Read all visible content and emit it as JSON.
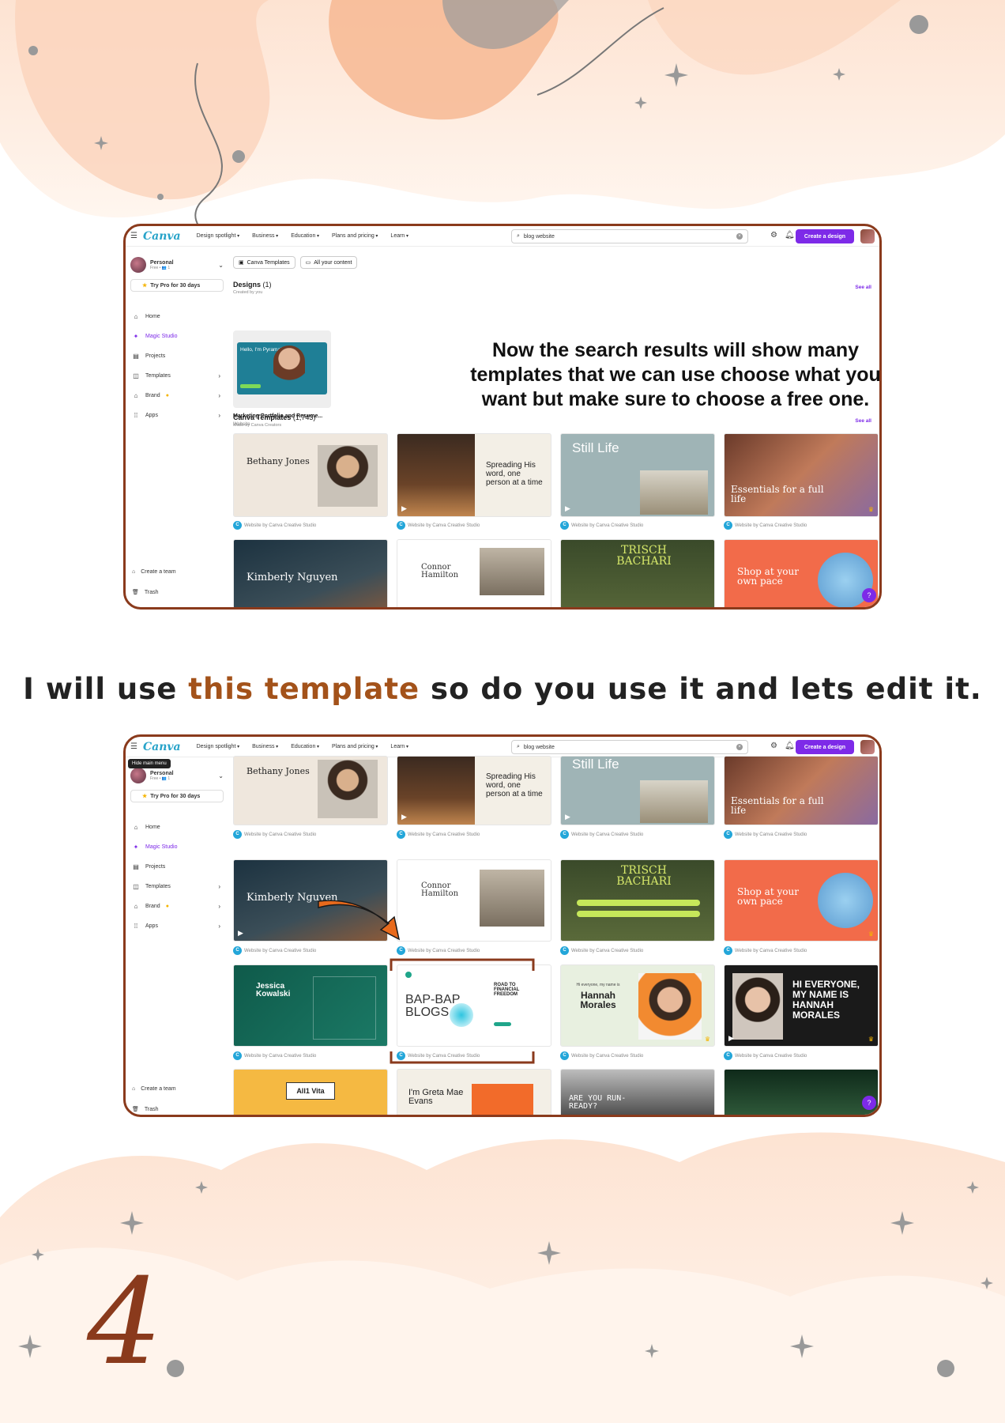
{
  "colors": {
    "accent": "#7d2ae8",
    "frame": "#8a3a1c",
    "highlight": "#a3521a",
    "brand": "#27a3c9"
  },
  "canva": {
    "logo": "Canva",
    "menu_icon": "menu-icon",
    "nav": [
      "Design spotlight",
      "Business",
      "Education",
      "Plans and pricing",
      "Learn"
    ],
    "search_value": "blog website",
    "create_button": "Create a design",
    "account": {
      "name": "Personal",
      "plan": "Free • 👥 1"
    },
    "try_pro": "Try Pro for 30 days",
    "sidebar": [
      {
        "label": "Home",
        "icon": "home-icon"
      },
      {
        "label": "Magic Studio",
        "icon": "sparkle-icon"
      },
      {
        "label": "Projects",
        "icon": "folder-icon"
      },
      {
        "label": "Templates",
        "icon": "templates-icon"
      },
      {
        "label": "Brand",
        "icon": "brand-icon"
      },
      {
        "label": "Apps",
        "icon": "apps-icon"
      }
    ],
    "create_team": "Create a team",
    "trash": "Trash",
    "template_card_label": "Website by Canva Creative Studio",
    "tooltip": "Hide main menu"
  },
  "screen1": {
    "chips": [
      "Canva Templates",
      "All your content"
    ],
    "designs_title": "Designs",
    "designs_count": "(1)",
    "designs_sub": "Created by you",
    "see_all": "See all",
    "design_card": {
      "thumb_text": "Hello, I'm Pyramaka",
      "name": "Marketing Portfolio and Resume...",
      "type": "Website"
    },
    "templates_title": "Canva Templates",
    "templates_count": "(1,743)",
    "templates_sub": "Made by Canva Creators",
    "callout": "Now the search results will show many templates that we can use choose what you want but make sure to choose a free one.",
    "row1": [
      "Bethany Jones",
      "Spreading His word, one person at a time",
      "Still Life",
      "Essentials for a full life"
    ],
    "row2": [
      "Kimberly Nguyen",
      "Connor Hamilton",
      "TRISCH BACHARI",
      "Shop at your own pace"
    ]
  },
  "heading2": {
    "part1": "I will use",
    "highlight": "this template",
    "part2": "so do you use it and lets edit it."
  },
  "screen2": {
    "row1": [
      "Bethany Jones",
      "Spreading His word, one person at a time",
      "Still Life",
      "Essentials for a full life"
    ],
    "row2": [
      "Kimberly Nguyen",
      "Connor Hamilton",
      "TRISCH BACHARI",
      "Shop at your own pace"
    ],
    "row3": [
      "Jessica Kowalski",
      "BAP-BAP BLOGS",
      "Hannah Morales",
      "HI EVERYONE, MY NAME IS HANNAH MORALES"
    ],
    "row3_extra": {
      "bap_side": "ROAD TO FINANCIAL FREEDOM",
      "hannah_intro": "Hi everyone, my name is"
    },
    "row4": [
      "All1 Vita",
      "I'm Greta Mae Evans",
      "ARE YOU RUN-READY?",
      ""
    ]
  },
  "step_number": "4"
}
